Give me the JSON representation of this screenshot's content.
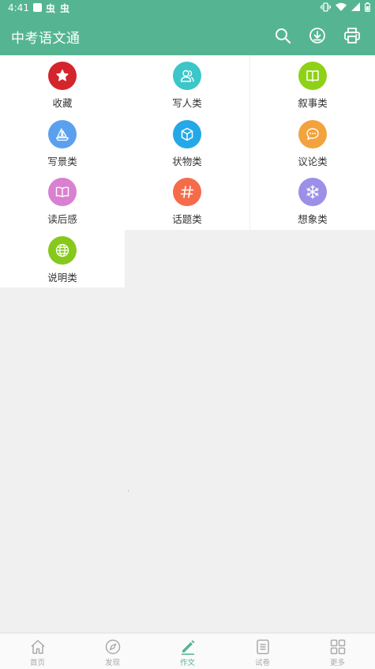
{
  "status_bar": {
    "time": "4:41"
  },
  "app_bar": {
    "title": "中考语文通",
    "actions": [
      "search-icon",
      "download-icon",
      "print-icon"
    ]
  },
  "colors": {
    "primary": "#55b592",
    "favorites": "#d3252b",
    "people": "#3cc6c8",
    "narrative": "#8fd117",
    "scenery": "#5aa0ee",
    "objects": "#24a8e8",
    "argument": "#f3a33d",
    "reflection": "#da80d0",
    "topic": "#f56c4a",
    "imagination": "#9c8fe8",
    "explanation": "#86c91b"
  },
  "categories": [
    {
      "label": "收藏",
      "icon": "star-icon"
    },
    {
      "label": "写人类",
      "icon": "people-icon"
    },
    {
      "label": "叙事类",
      "icon": "book-open-icon"
    },
    {
      "label": "写景类",
      "icon": "sailboat-icon"
    },
    {
      "label": "状物类",
      "icon": "cube-icon"
    },
    {
      "label": "议论类",
      "icon": "chat-bubble-icon"
    },
    {
      "label": "读后感",
      "icon": "book-icon"
    },
    {
      "label": "话题类",
      "icon": "hashtag-icon"
    },
    {
      "label": "想象类",
      "icon": "snowflake-icon"
    },
    {
      "label": "说明类",
      "icon": "globe-icon"
    }
  ],
  "bottom_nav": [
    {
      "label": "首页",
      "icon": "home-icon",
      "active": false
    },
    {
      "label": "发现",
      "icon": "compass-icon",
      "active": false
    },
    {
      "label": "作文",
      "icon": "pencil-icon",
      "active": true
    },
    {
      "label": "试卷",
      "icon": "document-icon",
      "active": false
    },
    {
      "label": "更多",
      "icon": "grid-icon",
      "active": false
    }
  ]
}
